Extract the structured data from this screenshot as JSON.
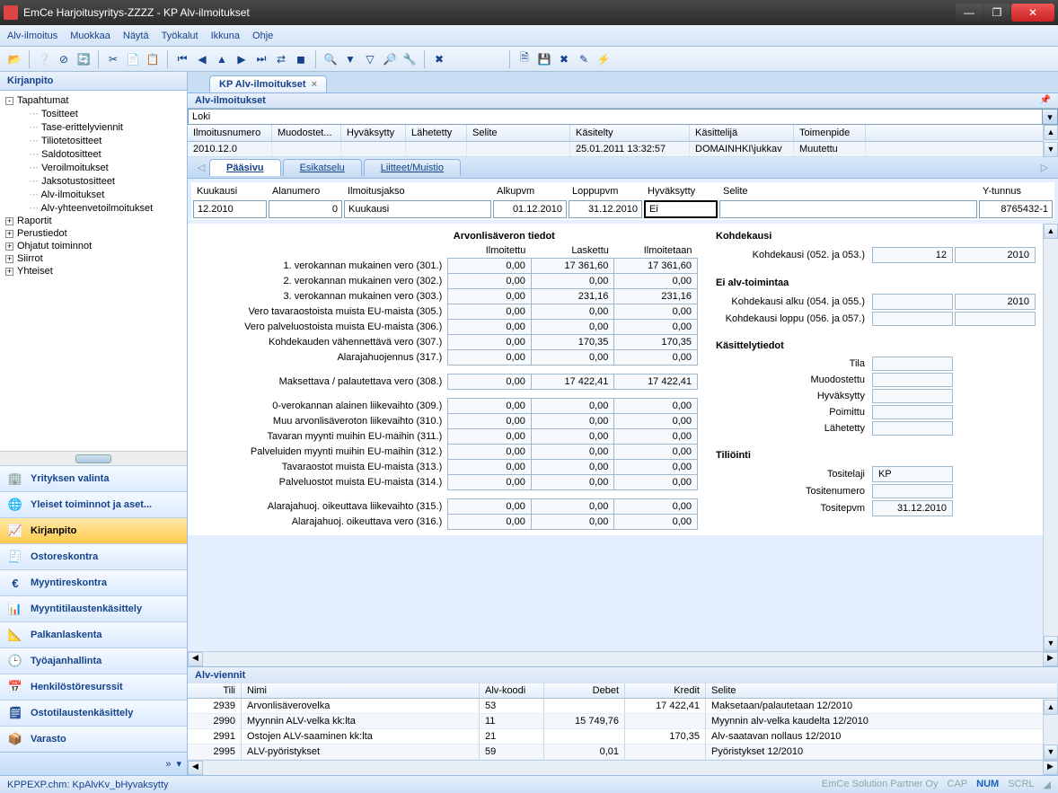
{
  "window": {
    "title": "EmCe  Harjoitusyritys-ZZZZ - KP Alv-ilmoitukset"
  },
  "menu": [
    "Alv-ilmoitus",
    "Muokkaa",
    "Näytä",
    "Työkalut",
    "Ikkuna",
    "Ohje"
  ],
  "sidebar": {
    "title": "Kirjanpito",
    "tree": [
      {
        "label": "Tapahtumat",
        "indent": 0,
        "box": "-"
      },
      {
        "label": "Tositteet",
        "indent": 1
      },
      {
        "label": "Tase-erittelyviennit",
        "indent": 1
      },
      {
        "label": "Tiliotetositteet",
        "indent": 1
      },
      {
        "label": "Saldotositteet",
        "indent": 1
      },
      {
        "label": "Veroilmoitukset",
        "indent": 1
      },
      {
        "label": "Jaksotustositteet",
        "indent": 1
      },
      {
        "label": "Alv-ilmoitukset",
        "indent": 1
      },
      {
        "label": "Alv-yhteenvetoilmoitukset",
        "indent": 1
      },
      {
        "label": "Raportit",
        "indent": 0,
        "box": "+"
      },
      {
        "label": "Perustiedot",
        "indent": 0,
        "box": "+"
      },
      {
        "label": "Ohjatut toiminnot",
        "indent": 0,
        "box": "+"
      },
      {
        "label": "Siirrot",
        "indent": 0,
        "box": "+"
      },
      {
        "label": "Yhteiset",
        "indent": 0,
        "box": "+"
      }
    ],
    "nav": [
      {
        "label": "Yrityksen valinta",
        "icon": "🏢"
      },
      {
        "label": "Yleiset toiminnot ja aset...",
        "icon": "🌐"
      },
      {
        "label": "Kirjanpito",
        "icon": "📈",
        "selected": true
      },
      {
        "label": "Ostoreskontra",
        "icon": "🧾"
      },
      {
        "label": "Myyntireskontra",
        "icon": "€"
      },
      {
        "label": "Myyntitilaustenkäsittely",
        "icon": "📊"
      },
      {
        "label": "Palkanlaskenta",
        "icon": "📐"
      },
      {
        "label": "Työajanhallinta",
        "icon": "🕒"
      },
      {
        "label": "Henkilöstöresurssit",
        "icon": "📅"
      },
      {
        "label": "Ostotilaustenkäsittely",
        "icon": "🗒"
      },
      {
        "label": "Varasto",
        "icon": "📦"
      }
    ]
  },
  "tab": {
    "label": "KP Alv-ilmoitukset"
  },
  "subheader": "Alv-ilmoitukset",
  "loki_label": "Loki",
  "log_grid": {
    "headers": [
      "Ilmoitusnumero",
      "Muodostet...",
      "Hyväksytty",
      "Lähetetty",
      "Selite",
      "Käsitelty",
      "Käsittelijä",
      "Toimenpide"
    ],
    "row": {
      "num": "2010.12.0",
      "kasitelty": "25.01.2011 13:32:57",
      "kasittelija": "DOMAINHKI\\jukkav",
      "toimenpide": "Muutettu"
    }
  },
  "subtabs": [
    "Pääsivu",
    "Esikatselu",
    "Liitteet/Muistio"
  ],
  "form_header": {
    "labels": [
      "Kuukausi",
      "Alanumero",
      "Ilmoitusjakso",
      "Alkupvm",
      "Loppupvm",
      "Hyväksytty",
      "Selite",
      "Y-tunnus"
    ],
    "values": {
      "kuukausi": "12.2010",
      "alanumero": "0",
      "jakso": "Kuukausi",
      "alkupvm": "01.12.2010",
      "loppupvm": "31.12.2010",
      "hyvaksytty": "Ei",
      "selite": "",
      "ytunnus": "8765432-1"
    }
  },
  "vat": {
    "section_title": "Arvonlisäveron tiedot",
    "col_headers": [
      "Ilmoitettu",
      "Laskettu",
      "Ilmoitetaan"
    ],
    "rows": [
      {
        "label": "1. verokannan mukainen vero (301.)",
        "v": [
          "0,00",
          "17 361,60",
          "17 361,60"
        ]
      },
      {
        "label": "2. verokannan mukainen vero (302.)",
        "v": [
          "0,00",
          "0,00",
          "0,00"
        ]
      },
      {
        "label": "3. verokannan mukainen vero (303.)",
        "v": [
          "0,00",
          "231,16",
          "231,16"
        ]
      },
      {
        "label": "Vero tavaraostoista muista EU-maista (305.)",
        "v": [
          "0,00",
          "0,00",
          "0,00"
        ]
      },
      {
        "label": "Vero palveluostoista muista EU-maista (306.)",
        "v": [
          "0,00",
          "0,00",
          "0,00"
        ]
      },
      {
        "label": "Kohdekauden vähennettävä vero (307.)",
        "v": [
          "0,00",
          "170,35",
          "170,35"
        ]
      },
      {
        "label": "Alarajahuojennus (317.)",
        "v": [
          "0,00",
          "0,00",
          "0,00"
        ]
      }
    ],
    "sum_row": {
      "label": "Maksettava / palautettava vero (308.)",
      "v": [
        "0,00",
        "17 422,41",
        "17 422,41"
      ]
    },
    "rows2": [
      {
        "label": "0-verokannan alainen liikevaihto (309.)",
        "v": [
          "0,00",
          "0,00",
          "0,00"
        ]
      },
      {
        "label": "Muu arvonlisäveroton liikevaihto (310.)",
        "v": [
          "0,00",
          "0,00",
          "0,00"
        ]
      },
      {
        "label": "Tavaran myynti muihin EU-maihin (311.)",
        "v": [
          "0,00",
          "0,00",
          "0,00"
        ]
      },
      {
        "label": "Palveluiden myynti muihin EU-maihin (312.)",
        "v": [
          "0,00",
          "0,00",
          "0,00"
        ]
      },
      {
        "label": "Tavaraostot muista EU-maista (313.)",
        "v": [
          "0,00",
          "0,00",
          "0,00"
        ]
      },
      {
        "label": "Palveluostot muista EU-maista (314.)",
        "v": [
          "0,00",
          "0,00",
          "0,00"
        ]
      }
    ],
    "rows3": [
      {
        "label": "Alarajahuoj. oikeuttava liikevaihto (315.)",
        "v": [
          "0,00",
          "0,00",
          "0,00"
        ]
      },
      {
        "label": "Alarajahuoj. oikeuttava vero (316.)",
        "v": [
          "0,00",
          "0,00",
          "0,00"
        ]
      }
    ]
  },
  "right": {
    "kohdekausi_title": "Kohdekausi",
    "kohdekausi_label": "Kohdekausi (052. ja 053.)",
    "kohdekausi_v1": "12",
    "kohdekausi_v2": "2010",
    "eialv_title": "Ei alv-toimintaa",
    "alku_label": "Kohdekausi alku (054. ja 055.)",
    "alku_v2": "2010",
    "loppu_label": "Kohdekausi loppu (056. ja 057.)",
    "kasittely_title": "Käsittelytiedot",
    "tila": "Tila",
    "muod": "Muodostettu",
    "hyv": "Hyväksytty",
    "poim": "Poimittu",
    "lah": "Lähetetty",
    "tili_title": "Tiliöinti",
    "tositelaji_l": "Tositelaji",
    "tositelaji_v": "KP",
    "tositenumero_l": "Tositenumero",
    "tositepvm_l": "Tositepvm",
    "tositepvm_v": "31.12.2010"
  },
  "bottom": {
    "title": "Alv-viennit",
    "headers": [
      "Tili",
      "Nimi",
      "Alv-koodi",
      "Debet",
      "Kredit",
      "Selite"
    ],
    "rows": [
      {
        "tili": "2939",
        "nimi": "Arvonlisäverovelka",
        "alv": "53",
        "debet": "",
        "kredit": "17 422,41",
        "selite": "Maksetaan/palautetaan 12/2010"
      },
      {
        "tili": "2990",
        "nimi": "Myynnin ALV-velka kk:lta",
        "alv": "11",
        "debet": "15 749,76",
        "kredit": "",
        "selite": "Myynnin alv-velka kaudelta 12/2010"
      },
      {
        "tili": "2991",
        "nimi": "Ostojen ALV-saaminen kk:lta",
        "alv": "21",
        "debet": "",
        "kredit": "170,35",
        "selite": "Alv-saatavan nollaus 12/2010"
      },
      {
        "tili": "2995",
        "nimi": "ALV-pyöristykset",
        "alv": "59",
        "debet": "0,01",
        "kredit": "",
        "selite": "Pyöristykset 12/2010"
      }
    ]
  },
  "status": {
    "left": "KPPEXP.chm: KpAlvKv_bHyvaksytty",
    "partner": "EmCe Solution Partner Oy",
    "cap": "CAP",
    "num": "NUM",
    "scrl": "SCRL"
  }
}
